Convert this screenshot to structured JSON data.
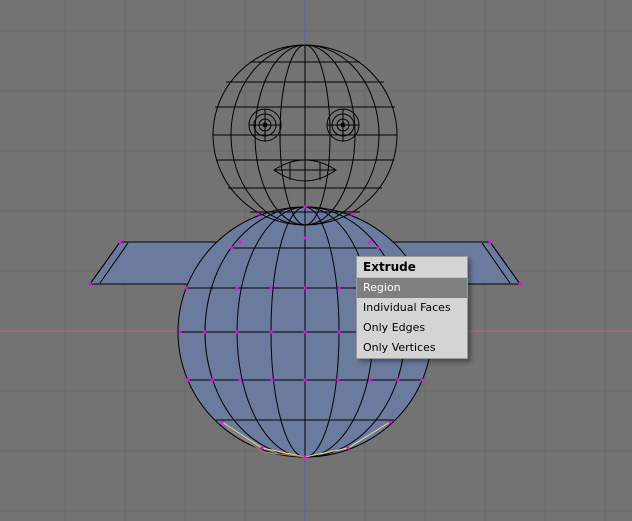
{
  "viewport": {
    "background": "#737373",
    "grid_color": "#6a6a6a",
    "x_axis_color": "#c06464",
    "y_axis_color": "#5a5acb",
    "mesh_color": "#000000",
    "selected_face_fill": "#6b7b9e",
    "vertex_color": "#ff00ff",
    "highlight_edge_color": "#f5e36a"
  },
  "extrude_menu": {
    "title": "Extrude",
    "items": [
      "Region",
      "Individual Faces",
      "Only Edges",
      "Only Vertices"
    ],
    "selected_index": 0
  }
}
